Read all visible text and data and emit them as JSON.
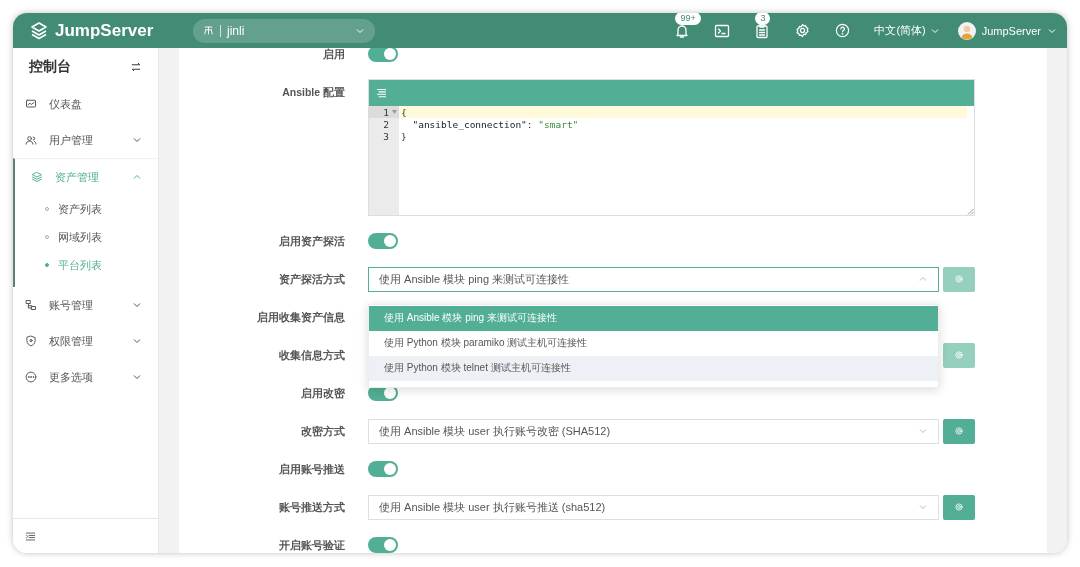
{
  "header": {
    "logo": "JumpServer",
    "org": "jinli",
    "icons": [
      {
        "kind": "bell",
        "badge": "99+"
      },
      {
        "kind": "terminal"
      },
      {
        "kind": "clipboard",
        "badge": "3"
      },
      {
        "kind": "settings"
      },
      {
        "kind": "help"
      }
    ],
    "language": "中文(简体)",
    "user": "JumpServer"
  },
  "sidebar": {
    "title": "控制台",
    "items": [
      {
        "label": "仪表盘",
        "kind": "link",
        "selected": false
      },
      {
        "label": "用户管理",
        "kind": "group",
        "expanded": false,
        "selected": false
      },
      {
        "label": "资产管理",
        "kind": "group",
        "expanded": true,
        "selected": true,
        "children": [
          {
            "label": "资产列表",
            "selected": false
          },
          {
            "label": "网域列表",
            "selected": false
          },
          {
            "label": "平台列表",
            "selected": true
          }
        ]
      },
      {
        "label": "账号管理",
        "kind": "group",
        "expanded": false,
        "selected": false
      },
      {
        "label": "权限管理",
        "kind": "group",
        "expanded": false,
        "selected": false
      },
      {
        "label": "更多选项",
        "kind": "group",
        "expanded": false,
        "selected": false
      }
    ]
  },
  "form": {
    "rows": [
      {
        "label": "启用",
        "kind": "toggle",
        "on": true
      },
      {
        "label": "Ansible 配置",
        "kind": "editor",
        "lines": [
          {
            "number": "1",
            "active": true,
            "fold": true,
            "tokens": [
              {
                "text": "{",
                "kind": "punct"
              }
            ]
          },
          {
            "number": "2",
            "active": false,
            "fold": false,
            "tokens": [
              {
                "text": "  \"ansible_connection\"",
                "kind": "key"
              },
              {
                "text": ": ",
                "kind": "punct"
              },
              {
                "text": "\"smart\"",
                "kind": "string"
              }
            ]
          },
          {
            "number": "3",
            "active": false,
            "fold": false,
            "tokens": [
              {
                "text": "}",
                "kind": "punct"
              }
            ]
          }
        ]
      },
      {
        "label": "启用资产探活",
        "kind": "toggle",
        "on": true
      },
      {
        "label": "资产探活方式",
        "kind": "select",
        "value": "使用 Ansible 模块 ping 来测试可连接性",
        "open": true,
        "button_disabled": true,
        "options": [
          {
            "label": "使用 Ansible 模块 ping 来测试可连接性",
            "selected": true,
            "hovered": false
          },
          {
            "label": "使用 Python 模块 paramiko 测试主机可连接性",
            "selected": false,
            "hovered": false
          },
          {
            "label": "使用 Python 模块 telnet 测试主机可连接性",
            "selected": false,
            "hovered": true
          }
        ]
      },
      {
        "label": "启用收集资产信息",
        "kind": "covered"
      },
      {
        "label": "收集信息方式",
        "kind": "button_only",
        "button_disabled": true
      },
      {
        "label": "启用改密",
        "kind": "toggle",
        "on": true
      },
      {
        "label": "改密方式",
        "kind": "select",
        "value": "使用 Ansible 模块 user 执行账号改密 (SHA512)",
        "open": false,
        "button_disabled": false
      },
      {
        "label": "启用账号推送",
        "kind": "toggle",
        "on": true
      },
      {
        "label": "账号推送方式",
        "kind": "select",
        "value": "使用 Ansible 模块 user 执行账号推送 (sha512)",
        "open": false,
        "button_disabled": false
      },
      {
        "label": "开启账号验证",
        "kind": "toggle",
        "on": true
      }
    ]
  }
}
